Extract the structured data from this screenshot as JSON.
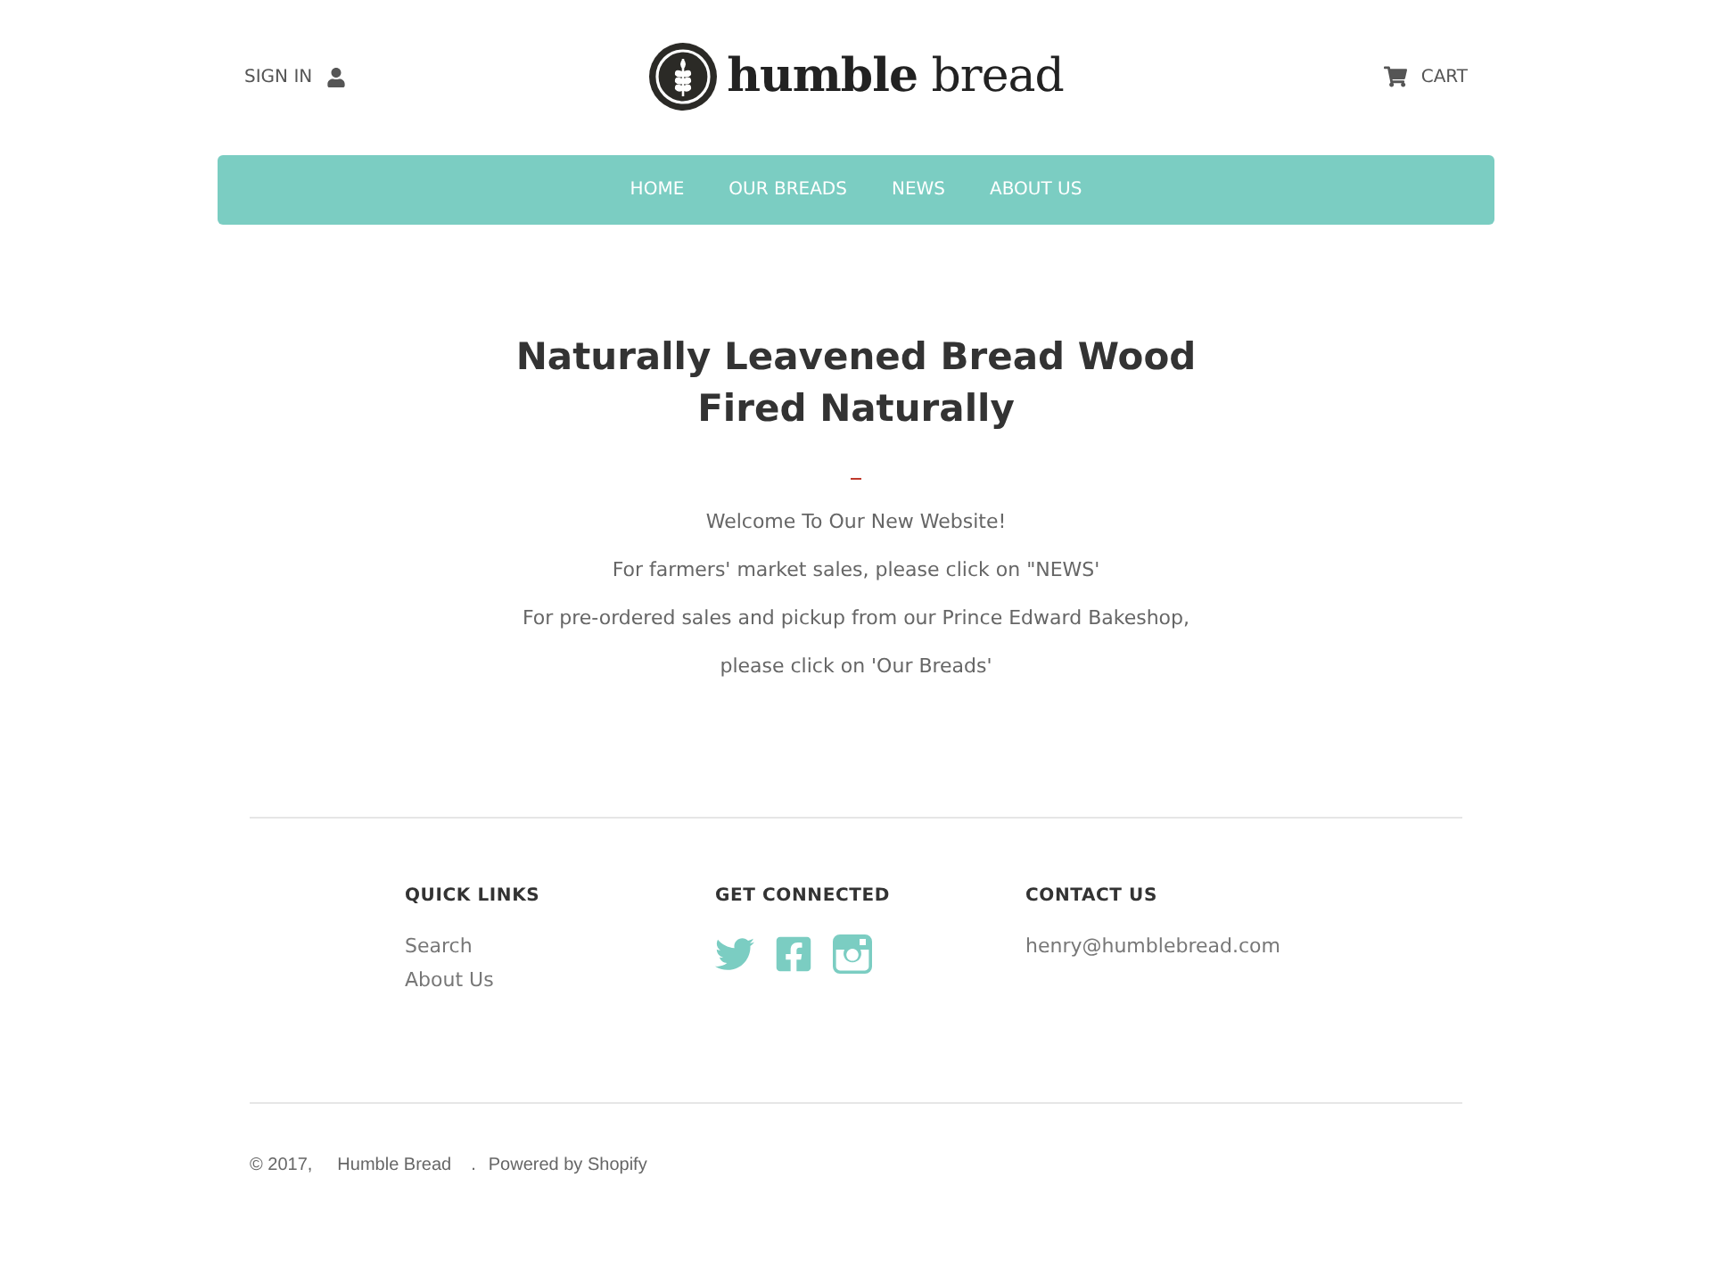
{
  "header": {
    "sign_in": "SIGN IN",
    "logo": "**humble** bread",
    "cart": "CART"
  },
  "nav": [
    {
      "label": "HOME"
    },
    {
      "label": "OUR BREADS"
    },
    {
      "label": "NEWS"
    },
    {
      "label": "ABOUT US"
    }
  ],
  "main": {
    "title": "Naturally Leavened Bread Wood Fired Naturally",
    "paragraphs": [
      "Welcome To Our New Website!",
      "For farmers' market sales, please click on \"NEWS'",
      "For pre-ordered sales and pickup from our Prince Edward Bakeshop,",
      "please click on 'Our Breads'"
    ]
  },
  "footer": {
    "columns": [
      {
        "kind": "links",
        "heading": "QUICK LINKS",
        "links": [
          "Search",
          "About Us"
        ]
      },
      {
        "kind": "social",
        "heading": "GET CONNECTED"
      },
      {
        "kind": "text",
        "heading": "CONTACT US",
        "text": "henry@humblebread.com"
      }
    ]
  },
  "copyright": {
    "year": "© 2017,",
    "site": "Humble Bread",
    "separator": ".",
    "powered": "Powered by Shopify"
  }
}
